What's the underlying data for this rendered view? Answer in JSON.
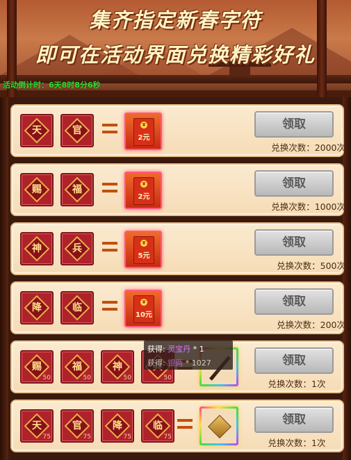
{
  "banner": {
    "line1": "集齐指定新春字符",
    "line2": "即可在活动界面兑换精彩好礼",
    "countdown_label": "活动倒计时：",
    "countdown_value": "6天8时8分6秒"
  },
  "claim_label": "领取",
  "rows": [
    {
      "chars": [
        "天",
        "官"
      ],
      "reward_amount": "2元",
      "times": "兑换次数：2000次"
    },
    {
      "chars": [
        "赐",
        "福"
      ],
      "reward_amount": "2元",
      "times": "兑换次数：1000次"
    },
    {
      "chars": [
        "神",
        "兵"
      ],
      "reward_amount": "5元",
      "times": "兑换次数：500次"
    },
    {
      "chars": [
        "降",
        "临"
      ],
      "reward_amount": "10元",
      "times": "兑换次数：200次"
    },
    {
      "chars": [
        "赐",
        "福",
        "神",
        "兵"
      ],
      "counts": [
        "50",
        "50",
        "50",
        "50"
      ],
      "times": "兑换次数：1次"
    },
    {
      "chars": [
        "天",
        "官",
        "降",
        "临"
      ],
      "counts": [
        "75",
        "75",
        "75",
        "75"
      ],
      "times": "兑换次数：1次"
    }
  ],
  "tooltip": {
    "prefix1": "获得: ",
    "item1": "灵宝丹",
    "qty1": " * 1",
    "prefix2": "获得: ",
    "item2": "银两",
    "qty2": " * 1027"
  },
  "colors": {
    "countdown": "#2fe02f",
    "tile_red": "#b0222a",
    "claim_button": "#c8c8c8",
    "tooltip_item": "#e070ff"
  }
}
